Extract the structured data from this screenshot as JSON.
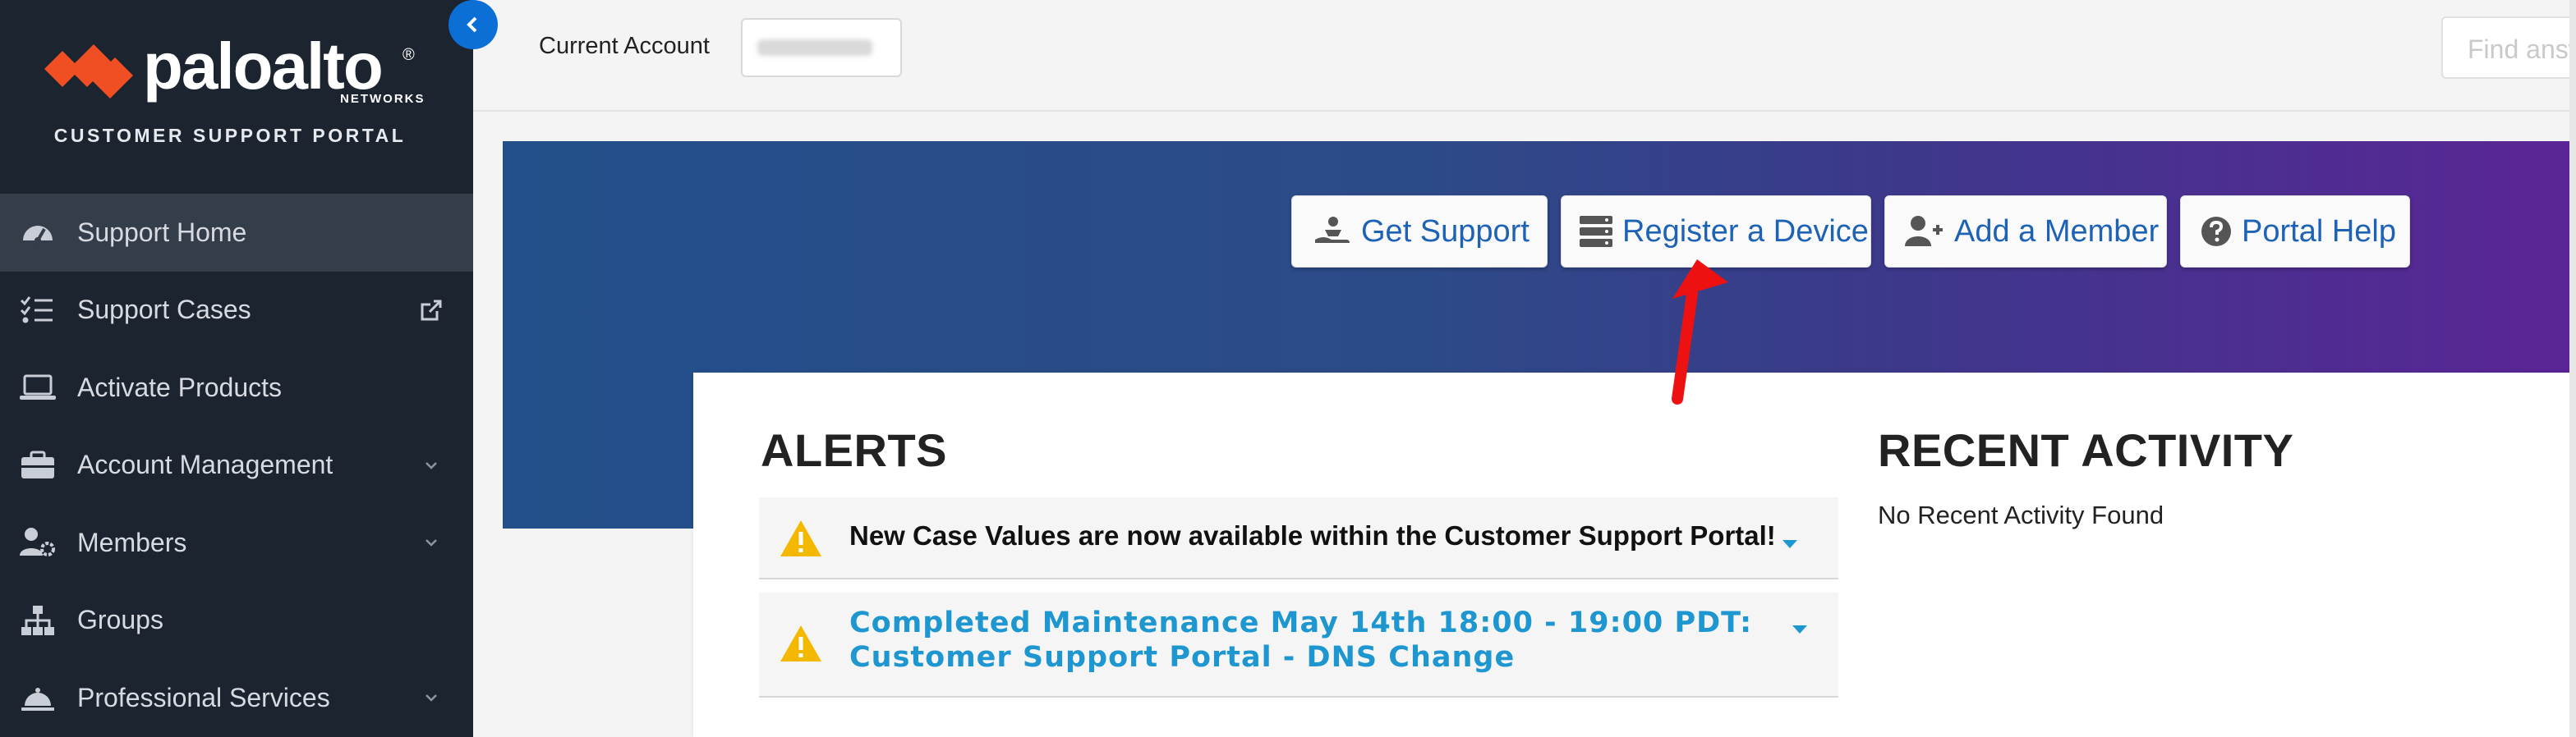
{
  "brand": {
    "logo_text": "paloalto",
    "logo_reg": "®",
    "logo_sub": "NETWORKS",
    "portal_title": "CUSTOMER SUPPORT PORTAL"
  },
  "sidebar": {
    "items": [
      {
        "label": "Support Home",
        "icon": "dashboard-icon",
        "active": true
      },
      {
        "label": "Support Cases",
        "icon": "checklist-icon",
        "right_icon": "external-link-icon"
      },
      {
        "label": "Activate Products",
        "icon": "laptop-icon"
      },
      {
        "label": "Account Management",
        "icon": "briefcase-icon",
        "right_icon": "chevron-down-icon"
      },
      {
        "label": "Members",
        "icon": "user-gear-icon",
        "right_icon": "chevron-down-icon"
      },
      {
        "label": "Groups",
        "icon": "sitemap-icon"
      },
      {
        "label": "Professional Services",
        "icon": "bell-service-icon",
        "right_icon": "chevron-down-icon"
      }
    ]
  },
  "topbar": {
    "account_label": "Current Account",
    "account_value_redacted": true,
    "search_placeholder": "Find answers"
  },
  "hero": {
    "buttons": [
      {
        "label": "Get Support",
        "icon": "hand-support-icon"
      },
      {
        "label": "Register a Device",
        "icon": "server-icon"
      },
      {
        "label": "Add a Member",
        "icon": "user-plus-icon"
      },
      {
        "label": "Portal Help",
        "icon": "question-circle-icon"
      }
    ]
  },
  "alerts": {
    "title": "ALERTS",
    "items": [
      {
        "text": "New Case Values are now available within the Customer Support Portal!"
      },
      {
        "text": "Completed Maintenance May 14th 18:00 - 19:00 PDT: Customer Support Portal - DNS Change"
      }
    ]
  },
  "recent_activity": {
    "title": "RECENT ACTIVITY",
    "empty_text": "No Recent Activity Found"
  },
  "colors": {
    "sidebar_bg": "#1c2430",
    "sidebar_active": "#343d4a",
    "logo_orange": "#f04e23",
    "link_blue": "#1e62b6",
    "alert_blue": "#1e97d0",
    "warning_yellow": "#f5b800",
    "annotation_red": "#ee1111"
  }
}
